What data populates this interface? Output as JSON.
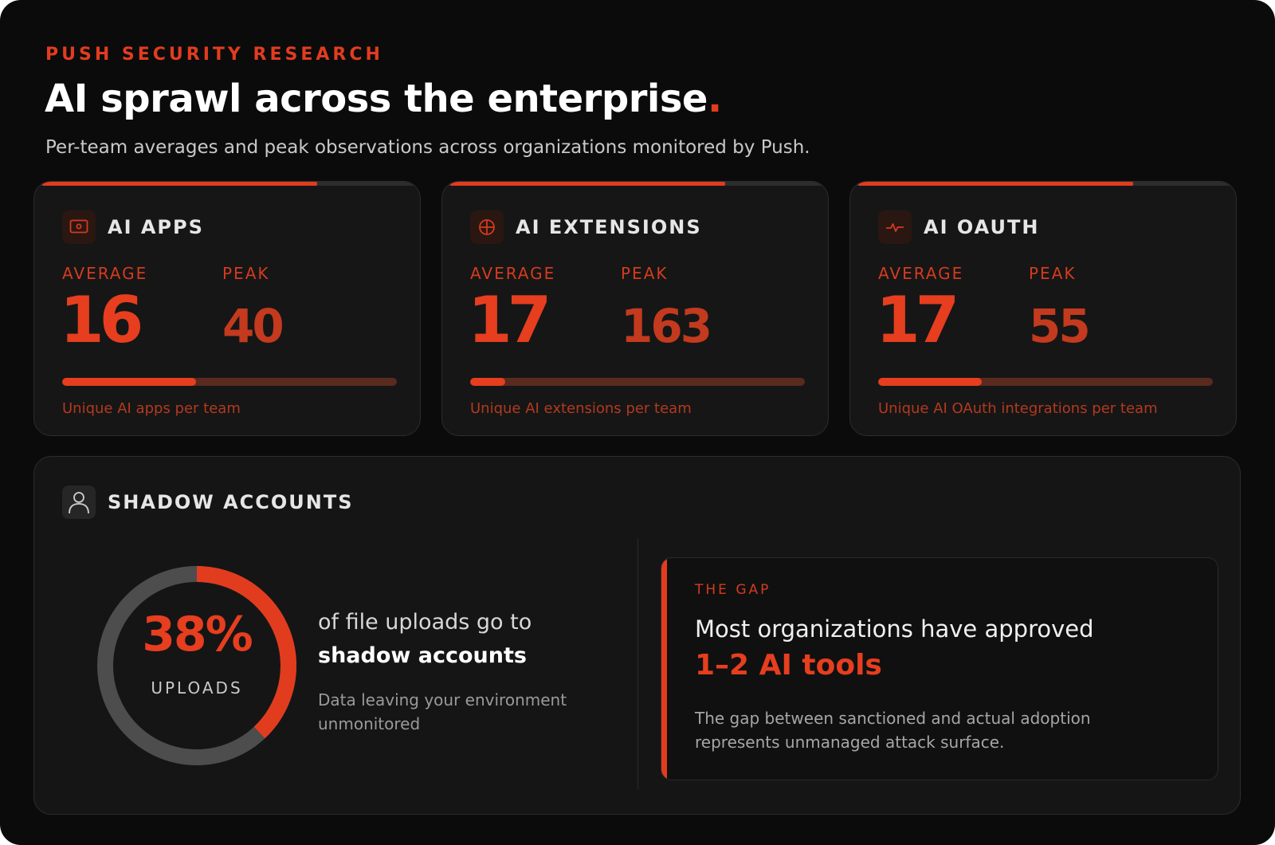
{
  "header": {
    "eyebrow": "PUSH SECURITY RESEARCH",
    "title": "AI sprawl across the enterprise",
    "title_dot": ".",
    "subtitle": "Per-team averages and peak observations across organizations monitored by Push."
  },
  "colors": {
    "accent": "#e23c1f",
    "background": "#0b0b0b",
    "card": "#161616",
    "track": "#5a2a1f",
    "donut_track": "#4d4d4d"
  },
  "cards": [
    {
      "icon": "browser-window-icon",
      "title": "AI APPS",
      "average_label": "AVERAGE",
      "average": "16",
      "peak_label": "PEAK",
      "peak": "40",
      "bar_fraction": 0.4,
      "caption": "Unique AI apps per team"
    },
    {
      "icon": "puzzle-extension-icon",
      "title": "AI EXTENSIONS",
      "average_label": "AVERAGE",
      "average": "17",
      "peak_label": "PEAK",
      "peak": "163",
      "bar_fraction": 0.104,
      "caption": "Unique AI extensions per team"
    },
    {
      "icon": "pulse-icon",
      "title": "AI OAUTH",
      "average_label": "AVERAGE",
      "average": "17",
      "peak_label": "PEAK",
      "peak": "55",
      "bar_fraction": 0.309,
      "caption": "Unique AI OAuth integrations per team"
    }
  ],
  "shadow": {
    "icon": "user-icon",
    "title": "SHADOW ACCOUNTS",
    "value": "38%",
    "fraction": 0.38,
    "value_label": "UPLOADS",
    "line1": "of file uploads go to",
    "line2": "shadow accounts",
    "desc": "Data leaving your environment unmonitored"
  },
  "gap": {
    "label": "THE GAP",
    "headline": "Most organizations have approved",
    "highlight": "1–2 AI tools",
    "desc": "The gap between sanctioned and actual adoption represents unmanaged attack surface."
  }
}
